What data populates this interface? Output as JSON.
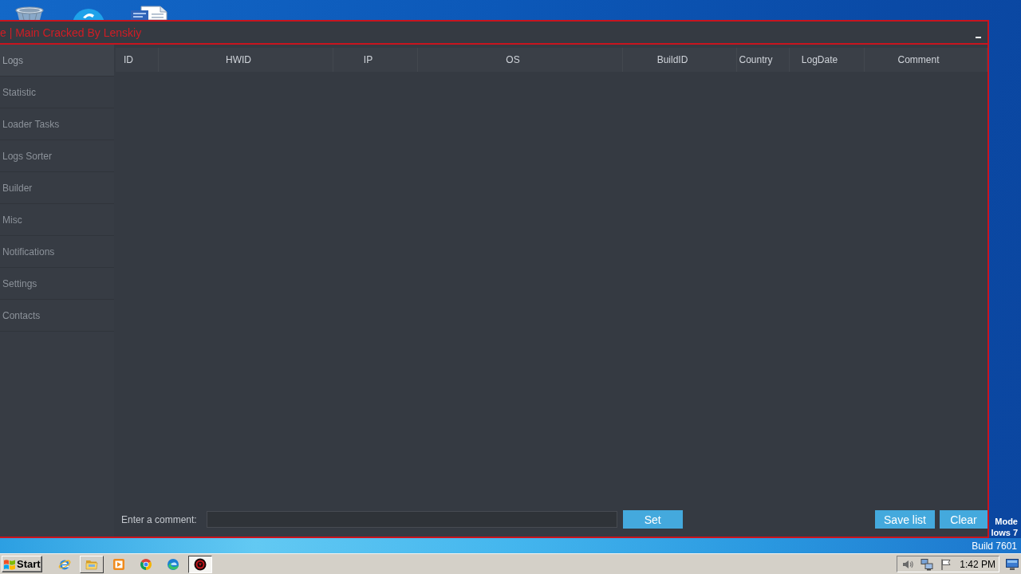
{
  "window": {
    "title": "e | Main Cracked By Lenskiy"
  },
  "sidebar": {
    "items": [
      {
        "label": "Logs",
        "selected": true
      },
      {
        "label": "Statistic",
        "selected": false
      },
      {
        "label": "Loader Tasks",
        "selected": false
      },
      {
        "label": "Logs Sorter",
        "selected": false
      },
      {
        "label": "Builder",
        "selected": false
      },
      {
        "label": "Misc",
        "selected": false
      },
      {
        "label": "Notifications",
        "selected": false
      },
      {
        "label": "Settings",
        "selected": false
      },
      {
        "label": "Contacts",
        "selected": false
      }
    ]
  },
  "table": {
    "columns": [
      "ID",
      "HWID",
      "IP",
      "OS",
      "BuildID",
      "Country",
      "LogDate",
      "Comment"
    ]
  },
  "comment_bar": {
    "label": "Enter a comment:",
    "submit": "Set"
  },
  "actions": [
    "Save list",
    "Clear"
  ],
  "desktop": {
    "notice": [
      "Mode",
      "lows 7"
    ],
    "build": "Build 7601"
  },
  "taskbar": {
    "start": "Start",
    "items": [
      {
        "kind": "e-globe",
        "open": false,
        "selected": false
      },
      {
        "kind": "folder",
        "open": true,
        "selected": false
      },
      {
        "kind": "player",
        "open": false,
        "selected": false
      },
      {
        "kind": "wheel",
        "open": false,
        "selected": false
      },
      {
        "kind": "swirl",
        "open": false,
        "selected": false
      },
      {
        "kind": "ring",
        "open": true,
        "selected": true
      }
    ],
    "clock": "1:42 PM"
  }
}
